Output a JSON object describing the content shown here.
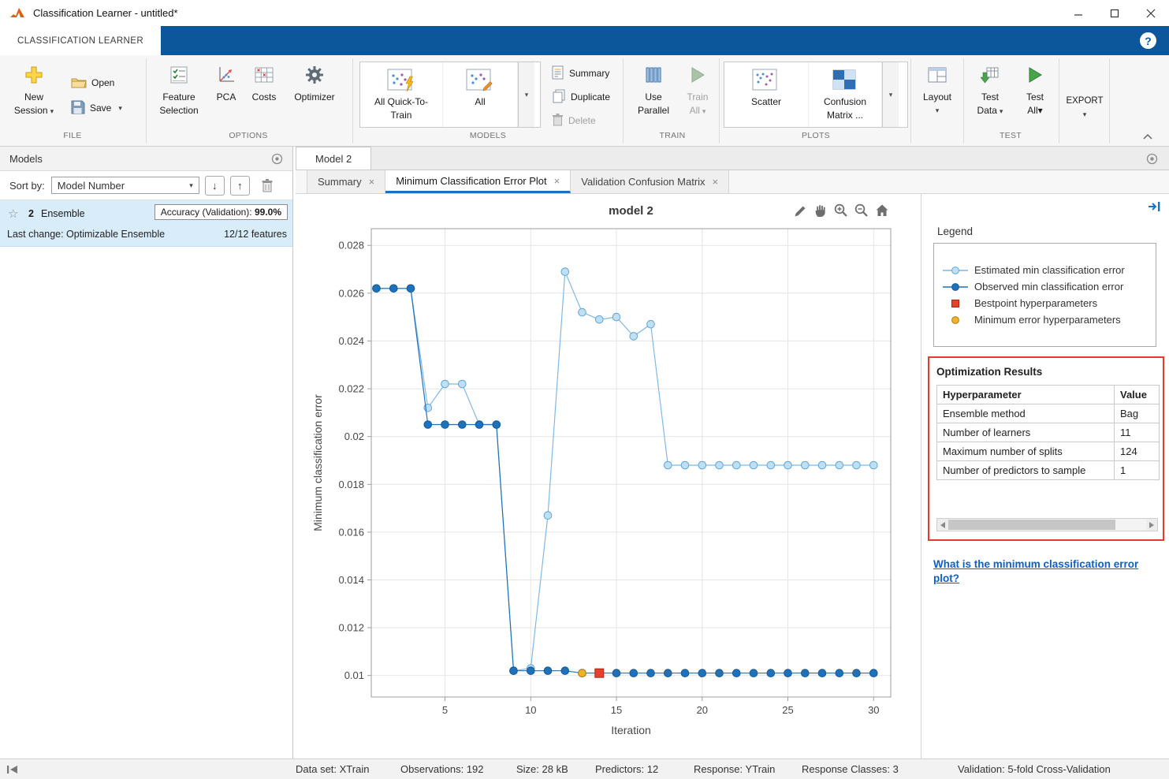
{
  "window": {
    "title": "Classification Learner - untitled*"
  },
  "ribbon": {
    "tab_label": "CLASSIFICATION LEARNER",
    "help_label": "?",
    "section_labels": {
      "file": "FILE",
      "options": "OPTIONS",
      "models": "MODELS",
      "train": "TRAIN",
      "plots": "PLOTS",
      "test": "TEST"
    },
    "file": {
      "new_l1": "New",
      "new_l2": "Session",
      "open": "Open",
      "save": "Save"
    },
    "options": {
      "feature_l1": "Feature",
      "feature_l2": "Selection",
      "pca": "PCA",
      "costs": "Costs",
      "optimizer": "Optimizer"
    },
    "models": {
      "quick_l1": "All Quick-To-",
      "quick_l2": "Train",
      "all": "All",
      "summary": "Summary",
      "duplicate": "Duplicate",
      "delete": "Delete"
    },
    "train": {
      "use_l1": "Use",
      "use_l2": "Parallel",
      "train_l1": "Train",
      "train_l2": "All"
    },
    "plots": {
      "scatter": "Scatter",
      "confusion_l1": "Confusion",
      "confusion_l2": "Matrix ..."
    },
    "layout": {
      "label": "Layout"
    },
    "test": {
      "data_l1": "Test",
      "data_l2": "Data",
      "all_l1": "Test",
      "all_l2": "All"
    },
    "export_label": "EXPORT"
  },
  "models_panel": {
    "title": "Models",
    "sort_label": "Sort by:",
    "sort_value": "Model Number",
    "card": {
      "number": "2",
      "type": "Ensemble",
      "accuracy_label": "Accuracy (Validation):",
      "accuracy_value": "99.0%",
      "last_change": "Last change: Optimizable Ensemble",
      "features": "12/12 features"
    }
  },
  "doc": {
    "tab": "Model 2",
    "subtabs": [
      {
        "label": "Summary"
      },
      {
        "label": "Minimum Classification Error Plot"
      },
      {
        "label": "Validation Confusion Matrix"
      }
    ]
  },
  "legend": {
    "title": "Legend",
    "items": [
      {
        "label": "Estimated min classification error",
        "fill": "#bfdff5",
        "line": "#7fb9e3",
        "edge": "#5fa6d6"
      },
      {
        "label": "Observed min classification error",
        "fill": "#1f72ba",
        "line": "#1f72ba",
        "edge": "#145a96"
      },
      {
        "label": "Bestpoint hyperparameters",
        "fill": "#e8402a",
        "edge": "#a52815"
      },
      {
        "label": "Minimum error hyperparameters",
        "fill": "#f0b12c",
        "edge": "#b07d0a"
      }
    ]
  },
  "optimization": {
    "title": "Optimization Results",
    "col1": "Hyperparameter",
    "col2": "Value",
    "rows": [
      {
        "name": "Ensemble method",
        "value": "Bag"
      },
      {
        "name": "Number of learners",
        "value": "11"
      },
      {
        "name": "Maximum number of splits",
        "value": "124"
      },
      {
        "name": "Number of predictors to sample",
        "value": "1"
      }
    ]
  },
  "help_link": "What is the minimum classification error plot?",
  "statusbar": {
    "dataset": "Data set: XTrain",
    "observations": "Observations: 192",
    "size": "Size: 28 kB",
    "predictors": "Predictors: 12",
    "response": "Response: YTrain",
    "classes": "Response Classes: 3",
    "validation": "Validation: 5-fold Cross-Validation"
  },
  "chart_data": {
    "type": "line",
    "title": "model 2",
    "xlabel": "Iteration",
    "ylabel": "Minimum classification error",
    "xlim": [
      0.7,
      31
    ],
    "ylim": [
      0.0091,
      0.0287
    ],
    "xticks": [
      5,
      10,
      15,
      20,
      25,
      30
    ],
    "yticks": [
      0.01,
      0.012,
      0.014,
      0.016,
      0.018,
      0.02,
      0.022,
      0.024,
      0.026,
      0.028
    ],
    "grid": true,
    "legend_position": "right-panel",
    "x": [
      1,
      2,
      3,
      4,
      5,
      6,
      7,
      8,
      9,
      10,
      11,
      12,
      13,
      14,
      15,
      16,
      17,
      18,
      19,
      20,
      21,
      22,
      23,
      24,
      25,
      26,
      27,
      28,
      29,
      30
    ],
    "series": [
      {
        "name": "Estimated min classification error",
        "line": "#7fb9e3",
        "fill": "#bfdff5",
        "edge": "#5fa6d6",
        "values": [
          0.0262,
          0.0262,
          0.0262,
          0.0212,
          0.0222,
          0.0222,
          0.0205,
          0.0205,
          0.0102,
          0.0103,
          0.0167,
          0.0269,
          0.0252,
          0.0249,
          0.025,
          0.0242,
          0.0247,
          0.0188,
          0.0188,
          0.0188,
          0.0188,
          0.0188,
          0.0188,
          0.0188,
          0.0188,
          0.0188,
          0.0188,
          0.0188,
          0.0188,
          0.0188
        ]
      },
      {
        "name": "Observed min classification error",
        "line": "#1f72ba",
        "fill": "#1f72ba",
        "edge": "#145a96",
        "values": [
          0.0262,
          0.0262,
          0.0262,
          0.0205,
          0.0205,
          0.0205,
          0.0205,
          0.0205,
          0.0102,
          0.0102,
          0.0102,
          0.0102,
          0.0101,
          0.0101,
          0.0101,
          0.0101,
          0.0101,
          0.0101,
          0.0101,
          0.0101,
          0.0101,
          0.0101,
          0.0101,
          0.0101,
          0.0101,
          0.0101,
          0.0101,
          0.0101,
          0.0101,
          0.0101
        ]
      }
    ],
    "bestpoint": {
      "x": 14,
      "y": 0.0101,
      "fill": "#e8402a",
      "edge": "#a52815",
      "label": "Bestpoint hyperparameters"
    },
    "min_error": {
      "x": 13,
      "y": 0.0101,
      "fill": "#f0b12c",
      "edge": "#b07d0a",
      "label": "Minimum error hyperparameters"
    }
  }
}
